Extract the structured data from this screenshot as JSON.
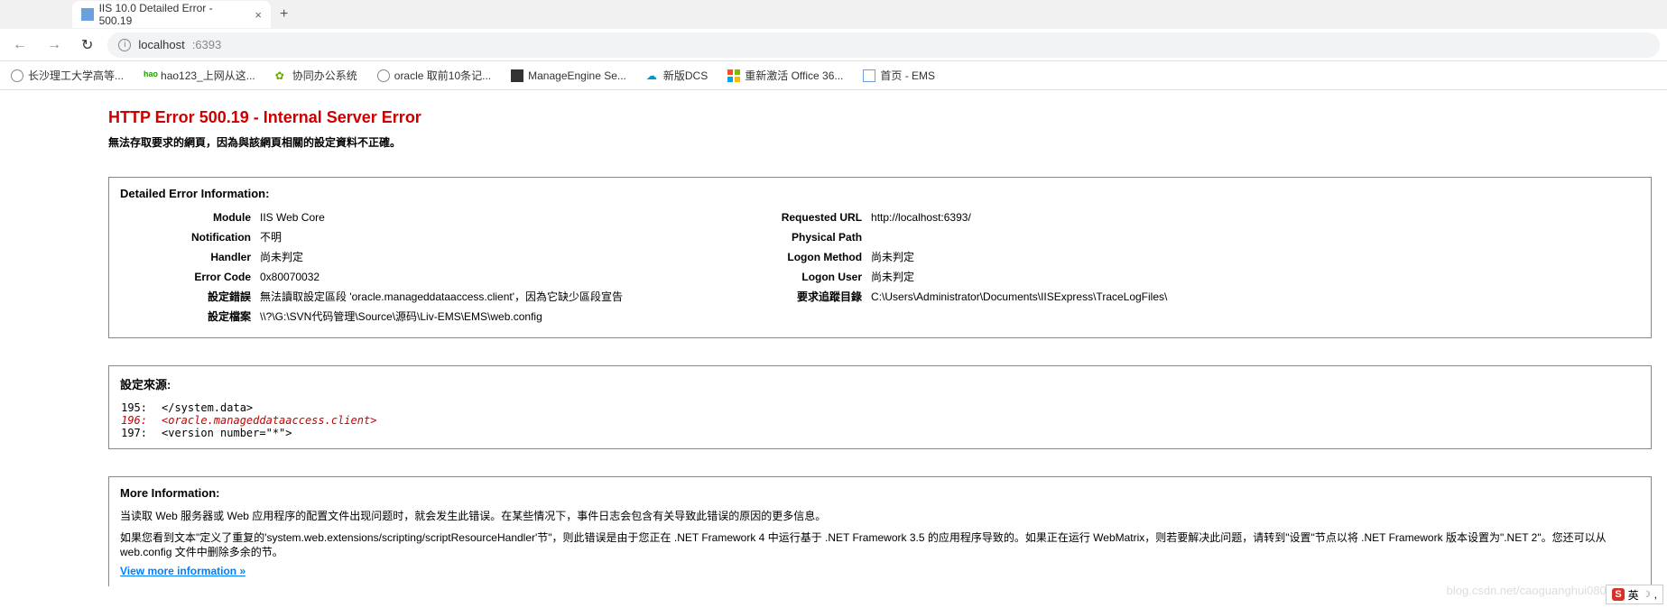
{
  "browser": {
    "tab_title": "IIS 10.0 Detailed Error - 500.19",
    "url_host": "localhost",
    "url_port": ":6393",
    "bookmarks": [
      "长沙理工大学高等...",
      "hao123_上网从这...",
      "协同办公系统",
      "oracle 取前10条记...",
      "ManageEngine Se...",
      "新版DCS",
      "重新激活 Office 36...",
      "首页 - EMS"
    ]
  },
  "error": {
    "title": "HTTP Error 500.19 - Internal Server Error",
    "subtitle": "無法存取要求的網頁，因為與該網頁相關的設定資料不正確。"
  },
  "detail": {
    "heading": "Detailed Error Information:",
    "left_labels": {
      "module": "Module",
      "notification": "Notification",
      "handler": "Handler",
      "error_code": "Error Code",
      "config_error": "設定錯誤",
      "config_file": "設定檔案"
    },
    "left_values": {
      "module": "IIS Web Core",
      "notification": "不明",
      "handler": "尚未判定",
      "error_code": "0x80070032",
      "config_error": "無法讀取設定區段 'oracle.manageddataaccess.client'，因為它缺少區段宣告",
      "config_file": "\\\\?\\G:\\SVN代码管理\\Source\\源码\\Liv-EMS\\EMS\\web.config"
    },
    "right_labels": {
      "requested_url": "Requested URL",
      "physical_path": "Physical Path",
      "logon_method": "Logon Method",
      "logon_user": "Logon User",
      "trace_dir": "要求追蹤目錄"
    },
    "right_values": {
      "requested_url": "http://localhost:6393/",
      "physical_path": "",
      "logon_method": "尚未判定",
      "logon_user": "尚未判定",
      "trace_dir": "C:\\Users\\Administrator\\Documents\\IISExpress\\TraceLogFiles\\"
    }
  },
  "config_source": {
    "heading": "設定來源:",
    "lines": [
      {
        "num": "195:",
        "code": "  </system.data>"
      },
      {
        "num": "196:",
        "code": "  <oracle.manageddataaccess.client>"
      },
      {
        "num": "197:",
        "code": "    <version number=\"*\">"
      }
    ],
    "error_index": 1
  },
  "more": {
    "heading": "More Information:",
    "p1": "当读取 Web 服务器或 Web 应用程序的配置文件出现问题时，就会发生此错误。在某些情况下，事件日志会包含有关导致此错误的原因的更多信息。",
    "p2": "如果您看到文本\"定义了重复的'system.web.extensions/scripting/scriptResourceHandler'节\"，则此错误是由于您正在 .NET Framework 4 中运行基于 .NET Framework 3.5 的应用程序导致的。如果正在运行 WebMatrix，则若要解决此问题，请转到\"设置\"节点以将 .NET Framework 版本设置为\".NET 2\"。您还可以从 web.config 文件中删除多余的节。",
    "link": "View more information »"
  },
  "watermark": "blog.csdn.net/caoguanghui0804",
  "ime": {
    "s": "S",
    "text": "英",
    "dot": "•",
    "comma": ","
  }
}
